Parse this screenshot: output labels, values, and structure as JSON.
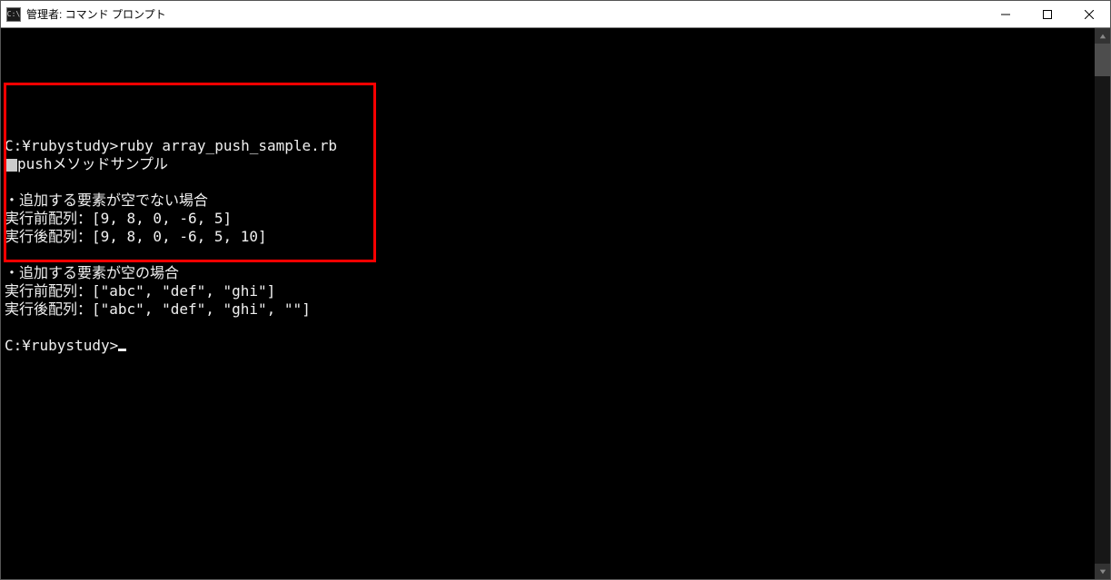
{
  "window": {
    "icon_text": "C:\\",
    "title": "管理者: コマンド プロンプト"
  },
  "terminal": {
    "cmd_line": "C:¥rubystudy>ruby array_push_sample.rb",
    "out1": "pushメソッドサンプル",
    "out2": "・追加する要素が空でない場合",
    "out3": "実行前配列：[9, 8, 0, -6, 5]",
    "out4": "実行後配列：[9, 8, 0, -6, 5, 10]",
    "out5": "・追加する要素が空の場合",
    "out6": "実行前配列：[\"abc\", \"def\", \"ghi\"]",
    "out7": "実行後配列：[\"abc\", \"def\", \"ghi\", \"\"]",
    "prompt": "C:¥rubystudy>"
  }
}
